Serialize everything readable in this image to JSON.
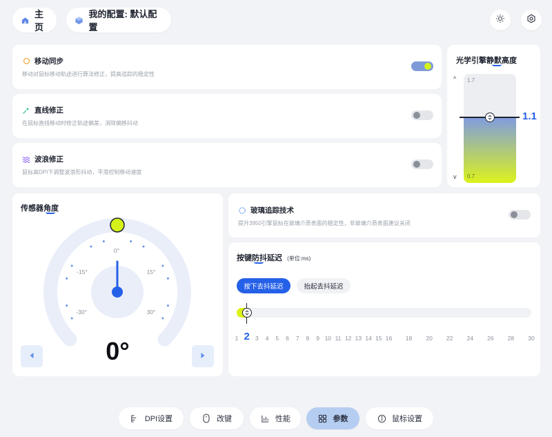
{
  "header": {
    "home_label": "主页",
    "config_label": "我的配置: 默认配置",
    "home_icon": "home-icon",
    "config_icon": "cube-icon",
    "theme_icon": "sun-icon",
    "settings_icon": "gear-icon"
  },
  "features": [
    {
      "title": "移动同步",
      "desc": "移动对鼠标移动轨迹进行算法修正，提高追踪的稳定性",
      "enabled": true,
      "icon": "sync-circle-icon",
      "icon_color": "#f0a020"
    },
    {
      "title": "直线修正",
      "desc": "在鼠标直线移动时修正轨迹偏差，消除偏移抖动",
      "enabled": false,
      "icon": "sparkle-line-icon",
      "icon_color": "#19b38c"
    },
    {
      "title": "波浪修正",
      "desc": "鼠标高DPI下调整波浪形抖动，平滑控制移动速度",
      "enabled": false,
      "icon": "wave-icon",
      "icon_color": "#8b5cf6"
    }
  ],
  "lod": {
    "title": "光学引擎静默高度",
    "max_label": "1.7",
    "min_label": "0.7",
    "up_arrow": "^",
    "down_arrow": "v",
    "value_label": "1.1",
    "level": 0.6
  },
  "sensor": {
    "title": "传感器角度",
    "value_label": "0°",
    "tick_labels": [
      "-30°",
      "-15°",
      "0°",
      "15°",
      "30°"
    ],
    "angle": 0,
    "prev_icon": "arrow-left-icon",
    "next_icon": "arrow-right-icon"
  },
  "glass": {
    "title": "玻璃追踪技术",
    "desc": "提升3950引擎鼠标在玻璃介质表面的稳定性，非玻璃介质表面建议关闭",
    "enabled": false,
    "icon": "glass-tracking-icon"
  },
  "debounce": {
    "title": "按键防抖延迟",
    "unit": "(单位:ms)",
    "tabs": [
      {
        "label": "按下去抖延迟",
        "active": true
      },
      {
        "label": "抬起去抖延迟",
        "active": false
      }
    ],
    "value_label": "2",
    "value": 2,
    "ticks": [
      "1",
      "2",
      "3",
      "4",
      "5",
      "6",
      "7",
      "8",
      "9",
      "10",
      "11",
      "12",
      "13",
      "14",
      "15",
      "16",
      "18",
      "20",
      "22",
      "24",
      "26",
      "28",
      "30"
    ]
  },
  "bottom_nav": [
    {
      "label": "DPI设置",
      "icon": "dpi-sliders-icon",
      "active": false
    },
    {
      "label": "改键",
      "icon": "mouse-icon",
      "active": false
    },
    {
      "label": "性能",
      "icon": "bar-chart-icon",
      "active": false
    },
    {
      "label": "参数",
      "icon": "grid-icon",
      "active": true
    },
    {
      "label": "鼠标设置",
      "icon": "info-circle-icon",
      "active": false
    }
  ]
}
